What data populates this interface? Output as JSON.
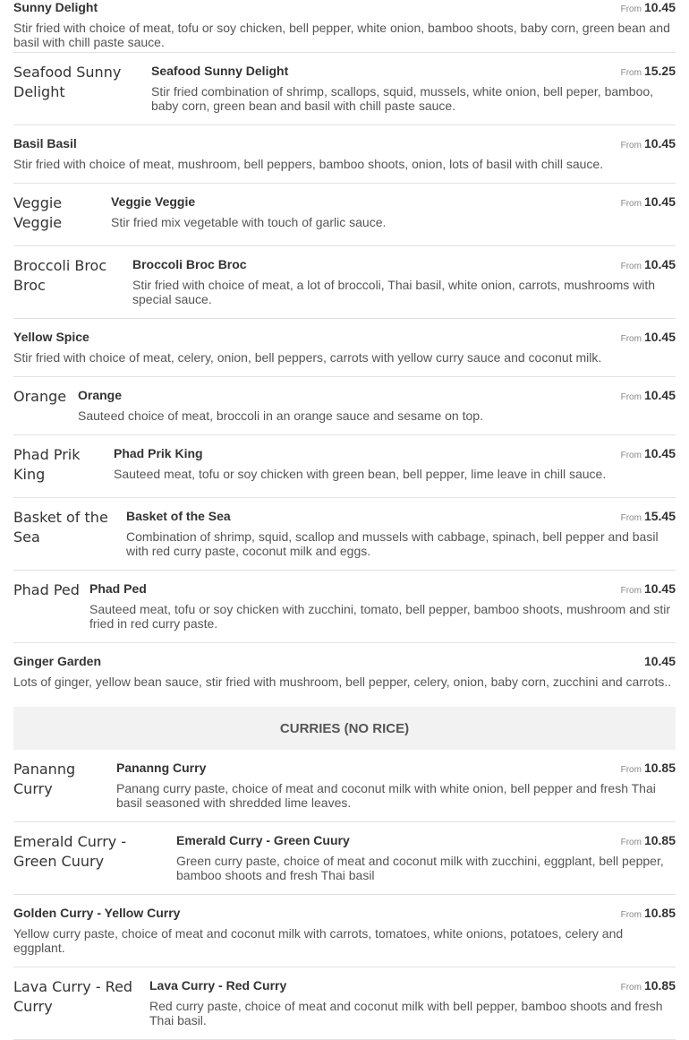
{
  "items": [
    {
      "name": "Sunny Delight",
      "from": "From",
      "price": "10.45",
      "img": "",
      "desc": "Stir fried with choice of meat, tofu or soy chicken, bell pepper, white onion, bamboo shoots, baby corn, green bean and basil with chill paste sauce."
    },
    {
      "name": "Seafood Sunny Delight",
      "from": "From",
      "price": "15.25",
      "img": "Seafood Sunny Delight",
      "desc": "Stir fried combination of shrimp, scallops, squid, mussels, white onion, bell peper, bamboo, baby corn, green bean and basil with chill paste sauce."
    },
    {
      "name": "Basil Basil",
      "from": "From",
      "price": "10.45",
      "img": "",
      "desc": "Stir fried with choice of meat, mushroom, bell peppers, bamboo shoots, onion, lots of basil with chill sauce."
    },
    {
      "name": "Veggie Veggie",
      "from": "From",
      "price": "10.45",
      "img": "Veggie Veggie",
      "desc": "Stir fried mix vegetable with touch of garlic sauce."
    },
    {
      "name": "Broccoli Broc Broc",
      "from": "From",
      "price": "10.45",
      "img": "Broccoli Broc Broc",
      "desc": "Stir fried with choice of meat, a lot of broccoli, Thai basil, white onion, carrots, mushrooms with special sauce."
    },
    {
      "name": "Yellow Spice",
      "from": "From",
      "price": "10.45",
      "img": "",
      "desc": "Stir fried with choice of meat, celery, onion, bell peppers, carrots with yellow curry sauce and coconut milk."
    },
    {
      "name": "Orange",
      "from": "From",
      "price": "10.45",
      "img": "Orange",
      "desc": "Sauteed choice of meat, broccoli in an orange sauce and sesame on top."
    },
    {
      "name": "Phad Prik King",
      "from": "From",
      "price": "10.45",
      "img": "Phad Prik King",
      "desc": "Sauteed meat, tofu or soy chicken with green bean, bell pepper, lime leave in chill sauce."
    },
    {
      "name": "Basket of the Sea",
      "from": "From",
      "price": "15.45",
      "img": "Basket of the Sea",
      "desc": "Combination of shrimp, squid, scallop and mussels with cabbage, spinach, bell pepper and basil with red curry paste, coconut milk and eggs."
    },
    {
      "name": "Phad Ped",
      "from": "From",
      "price": "10.45",
      "img": "Phad Ped",
      "desc": "Sauteed meat, tofu or soy chicken with zucchini, tomato, bell pepper, bamboo shoots, mushroom and stir fried in red curry paste."
    },
    {
      "name": "Ginger Garden",
      "from": "",
      "price": "10.45",
      "img": "",
      "desc": "Lots of ginger, yellow bean sauce, stir fried with mushroom, bell pepper, celery, onion, baby corn, zucchini and carrots.."
    }
  ],
  "section_title": "CURRIES (NO RICE)",
  "curries": [
    {
      "name": "Pananng Curry",
      "from": "From",
      "price": "10.85",
      "img": "Pananng Curry",
      "desc": "Panang curry paste, choice of meat and coconut milk with white onion, bell pepper and fresh Thai basil seasoned with shredded lime leaves."
    },
    {
      "name": "Emerald Curry - Green Cuury",
      "from": "From",
      "price": "10.85",
      "img": "Emerald Curry - Green Cuury",
      "desc": "Green curry paste, choice of meat and coconut milk with zucchini, eggplant, bell pepper, bamboo shoots and fresh Thai basil"
    },
    {
      "name": "Golden Curry - Yellow Curry",
      "from": "From",
      "price": "10.85",
      "img": "",
      "desc": "Yellow curry paste, choice of meat and coconut milk with carrots, tomatoes, white onions, potatoes, celery and eggplant."
    },
    {
      "name": "Lava Curry - Red Curry",
      "from": "From",
      "price": "10.85",
      "img": "Lava Curry - Red Curry",
      "desc": "Red curry paste, choice of meat and coconut milk with bell pepper, bamboo shoots and fresh Thai basil."
    }
  ]
}
